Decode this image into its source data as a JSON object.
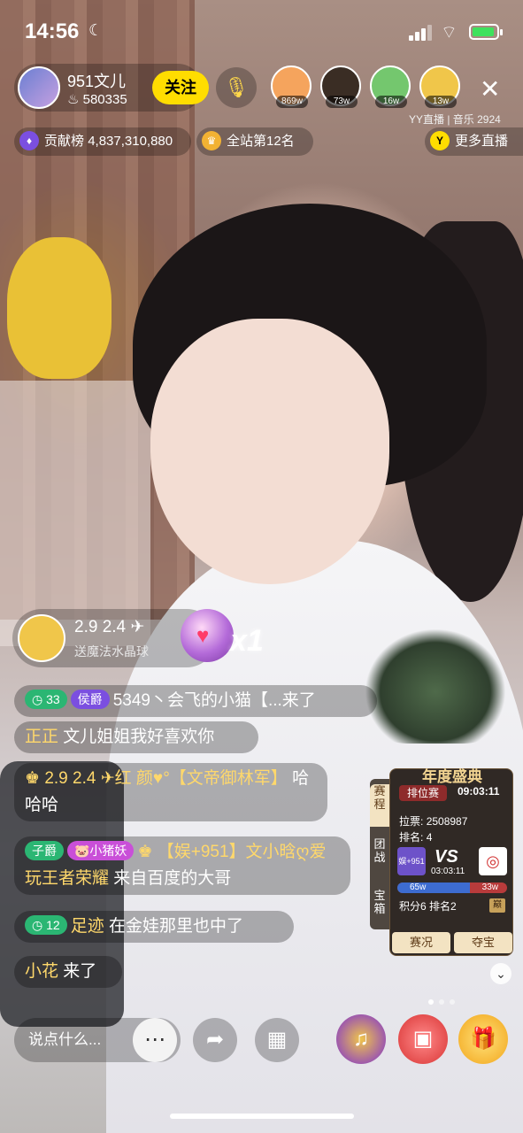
{
  "status_bar": {
    "time": "14:56",
    "moon": "☾",
    "wifi": "⌔"
  },
  "host": {
    "name": "951文儿",
    "fans": "580335",
    "fans_icon": "♨",
    "follow_label": "关注"
  },
  "mic_icon": "🎙",
  "viewers": [
    {
      "count": "869w",
      "color": "#f5a45d"
    },
    {
      "count": "73w",
      "color": "#3a2d24"
    },
    {
      "count": "16w",
      "color": "#74c76e"
    },
    {
      "count": "13w",
      "color": "#f0c64a"
    }
  ],
  "close_icon": "✕",
  "room_info": "YY直播 | 音乐 2924",
  "contribution": {
    "icon": "♦",
    "label": "贡献榜",
    "value": "4,837,310,880"
  },
  "site_rank": {
    "icon": "♛",
    "label": "全站第12名"
  },
  "more_live": {
    "icon": "Y",
    "label": "更多直播"
  },
  "gift_bar": {
    "sender": "2.9 2.4 ✈",
    "desc": "送魔法水晶球",
    "heart": "♥",
    "combo": "x1"
  },
  "messages": [
    {
      "badge_level": "33",
      "badge_title": "侯爵",
      "text": "5349丶会飞的小猫【...来了"
    },
    {
      "user": "正正",
      "text": "文儿姐姐我好喜欢你"
    },
    {
      "icon": "♚",
      "user": "2.9 2.4 ✈红  颜♥°【文帝御林军】",
      "text": "哈哈哈"
    },
    {
      "badge_title": "子爵",
      "badge_pet": "🐷小猪妖",
      "icon": "♚",
      "user": "【娱+951】文小晗ღ爱玩王者荣耀",
      "text": "来自百度的大哥"
    },
    {
      "badge_level": "12",
      "user": "足迹",
      "text": "在金娃那里也中了"
    },
    {
      "user": "小花",
      "text": "来了"
    }
  ],
  "event_panel": {
    "title": "年度盛典",
    "tabs": [
      "赛程",
      "团战",
      "宝箱"
    ],
    "rank_tag": "排位赛",
    "timer": "09:03:11",
    "votes_label": "拉票:",
    "votes_value": "2508987",
    "rank_label": "排名:",
    "rank_value": "4",
    "team_left": "娱+951",
    "vs_label": "VS",
    "vs_timer": "03:03:11",
    "left_score": "65w",
    "right_score": "33w",
    "left_share": 0.66,
    "points_text": "积分6 排名2",
    "tier_icon": "巅",
    "btn_status": "赛况",
    "btn_treasure": "夺宝"
  },
  "chevron": "⌄",
  "bottom_bar": {
    "input_placeholder": "说点什么...",
    "chat_icon": "⋯",
    "share_icon": "➦",
    "apps_icon": "▦",
    "gramophone_icon": "♫",
    "chest_icon": "▣",
    "gift_icon": "🎁"
  },
  "colors": {
    "accent_yellow": "#ffdd00",
    "badge_purple": "#7b4fe0",
    "badge_green": "#2bb673",
    "name_gold": "#ffd86b"
  }
}
